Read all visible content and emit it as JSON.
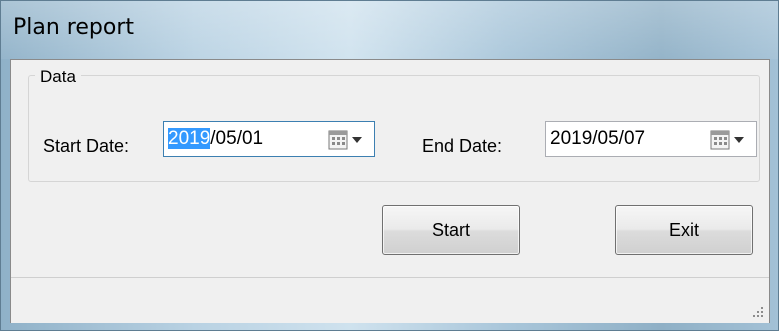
{
  "window": {
    "title": "Plan report"
  },
  "group": {
    "label": "Data",
    "start_label": "Start Date:",
    "start_value_selected": "2019",
    "start_value_rest": "/05/01",
    "end_label": "End Date:",
    "end_value": "2019/05/07"
  },
  "buttons": {
    "start": "Start",
    "exit": "Exit"
  },
  "icons": {
    "date_dropdown": "calendar-dropdown-icon",
    "resize": "resize-grip-icon"
  },
  "colors": {
    "selection": "#3399ff",
    "title_bar": "#b9d2e3"
  }
}
